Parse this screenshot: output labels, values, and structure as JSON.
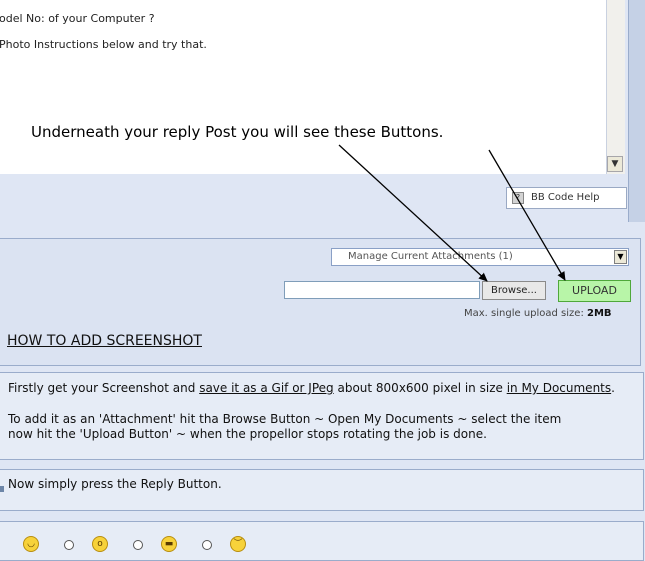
{
  "editor": {
    "lines": [
      "odel No: of your Computer ?",
      "Photo Instructions below and try that."
    ],
    "scroll_down_glyph": "▼"
  },
  "annotation": "Underneath your reply Post you will see these Buttons.",
  "bbcode": {
    "icon_glyph": "?",
    "label": "BB Code Help"
  },
  "attachments": {
    "manage_select": "Manage Current Attachments (1)",
    "select_arrow": "▼",
    "browse_label": "Browse...",
    "upload_label": "UPLOAD",
    "max_size_label": "Max. single upload size:",
    "max_size_value": "2MB"
  },
  "howto_title": "HOW TO ADD SCREENSHOT",
  "instructions": {
    "p1_a": "Firstly get your Screenshot and ",
    "p1_b": "save it as a Gif or JPeg",
    "p1_c": " about 800x600 pixel in size ",
    "p1_d": "in My Documents",
    "p1_e": ".",
    "p2": "To add it as an 'Attachment' hit tha Browse Button ~ Open My Documents ~ select the item",
    "p3": "now hit the 'Upload Button' ~ when the propellor stops rotating the job is done."
  },
  "reply_instruction": "Now simply press the Reply Button.",
  "smileys": [
    {
      "icon": "smile-icon",
      "glyph": "◡"
    },
    {
      "icon": "surprised-icon",
      "glyph": "o"
    },
    {
      "icon": "grin-icon",
      "glyph": "▬"
    },
    {
      "icon": "angry-icon",
      "glyph": "︶"
    }
  ],
  "colors": {
    "background": "#dfe6f4",
    "upload_button": "#b8f5a8",
    "panel_border": "#9aaccb"
  }
}
